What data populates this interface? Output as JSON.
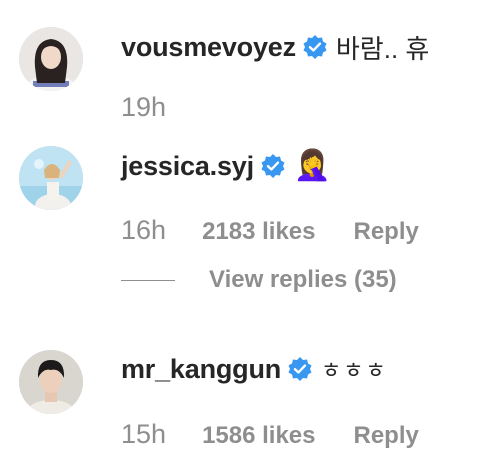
{
  "comments": [
    {
      "username": "vousmevoyez",
      "text": "바람.. 휴",
      "time": "19h",
      "likes": "",
      "reply_label": ""
    },
    {
      "username": "jessica.syj",
      "text": "🤦‍♀️",
      "time": "16h",
      "likes": "2183 likes",
      "reply_label": "Reply",
      "view_replies": "View replies (35)"
    },
    {
      "username": "mr_kanggun",
      "text": "ㅎㅎㅎ",
      "time": "15h",
      "likes": "1586 likes",
      "reply_label": "Reply"
    }
  ],
  "colors": {
    "verified_badge": "#3897f0",
    "primary_text": "#262626",
    "secondary_text": "#8e8e8e"
  },
  "icons": {
    "verified": "verified-badge-icon",
    "avatar": "profile-avatar"
  }
}
